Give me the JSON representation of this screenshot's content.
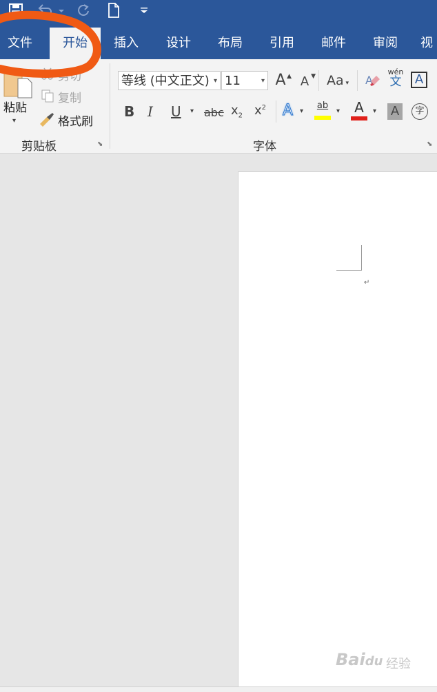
{
  "colors": {
    "brand": "#2b579a",
    "ribbon_bg": "#f3f3f3",
    "annotation": "#f05a14",
    "highlight": "#ffff00",
    "font_red": "#e0201a"
  },
  "qat": {
    "icons": [
      "save-icon",
      "undo-icon",
      "redo-icon",
      "new-document-icon",
      "customize-qat-icon"
    ]
  },
  "tabs": [
    {
      "label": "文件"
    },
    {
      "label": "开始"
    },
    {
      "label": "插入"
    },
    {
      "label": "设计"
    },
    {
      "label": "布局"
    },
    {
      "label": "引用"
    },
    {
      "label": "邮件"
    },
    {
      "label": "审阅"
    },
    {
      "label": "视"
    }
  ],
  "clipboard": {
    "paste_label": "粘贴",
    "cut_label": "剪切",
    "copy_label": "复制",
    "format_painter_label": "格式刷",
    "group_label": "剪贴板"
  },
  "font": {
    "font_name": "等线 (中文正文)",
    "font_size": "11",
    "grow_label": "A",
    "shrink_label": "A",
    "case_label": "Aa",
    "phonetic_label": "wén",
    "phonetic_char": "文",
    "border_char": "A",
    "bold": "B",
    "italic": "I",
    "underline": "U",
    "strike": "abc",
    "subscript": "x",
    "subscript_small": "2",
    "superscript": "x",
    "superscript_small": "2",
    "effects": "A",
    "highlight_label": "ab",
    "font_color": "A",
    "char_shading": "A",
    "enclose_char": "字",
    "group_label": "字体"
  },
  "document": {
    "paragraph_mark": "↵"
  },
  "watermark": {
    "text": "Bai",
    "text2": "经验",
    "paw": "du"
  }
}
